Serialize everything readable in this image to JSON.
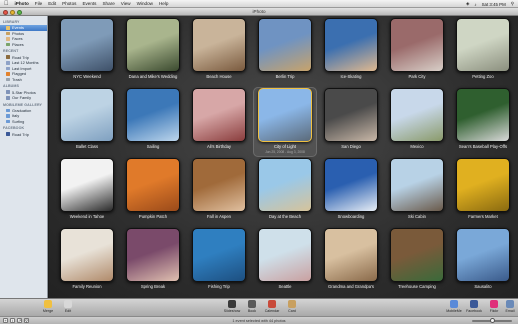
{
  "menubar": {
    "app": "iPhoto",
    "items": [
      "File",
      "Edit",
      "Photos",
      "Events",
      "Share",
      "View",
      "Window",
      "Help"
    ],
    "status": [
      "Sat 3:45 PM"
    ]
  },
  "window": {
    "title": "iPhoto"
  },
  "sidebar": {
    "sections": [
      {
        "title": "LIBRARY",
        "items": [
          {
            "label": "Events",
            "icon": "events-icon",
            "color": "#e8c26a",
            "selected": true
          },
          {
            "label": "Photos",
            "icon": "photos-icon",
            "color": "#c8a060"
          },
          {
            "label": "Faces",
            "icon": "faces-icon",
            "color": "#e1b780"
          },
          {
            "label": "Places",
            "icon": "places-icon",
            "color": "#7aa36a"
          }
        ]
      },
      {
        "title": "RECENT",
        "items": [
          {
            "label": "Road Trip",
            "icon": "event-icon",
            "color": "#8b6b3f"
          },
          {
            "label": "Last 12 Months",
            "icon": "calendar-icon",
            "color": "#8ea2c7"
          },
          {
            "label": "Last Import",
            "icon": "import-icon",
            "color": "#8ea2c7"
          },
          {
            "label": "Flagged",
            "icon": "flag-icon",
            "color": "#e3822c"
          },
          {
            "label": "Trash",
            "icon": "trash-icon",
            "color": "#9aa4ae"
          }
        ]
      },
      {
        "title": "ALBUMS",
        "items": [
          {
            "label": "5-Star Photos",
            "icon": "smart-album-icon",
            "color": "#7f93b9"
          },
          {
            "label": "Our Family",
            "icon": "album-icon",
            "color": "#7f93b9"
          }
        ]
      },
      {
        "title": "MOBILEME GALLERY",
        "items": [
          {
            "label": "Graduation",
            "icon": "gallery-icon",
            "color": "#6b9ad6"
          },
          {
            "label": "Italy",
            "icon": "gallery-icon",
            "color": "#6b9ad6"
          },
          {
            "label": "Surfing",
            "icon": "gallery-icon",
            "color": "#6b9ad6"
          }
        ]
      },
      {
        "title": "FACEBOOK",
        "items": [
          {
            "label": "Road Trip",
            "icon": "facebook-icon",
            "color": "#3b5998"
          }
        ]
      }
    ]
  },
  "events": [
    {
      "title": "NYC Weekend",
      "colors": [
        "#7f9bb8",
        "#3e5068"
      ]
    },
    {
      "title": "Dana and Mike's Wedding",
      "colors": [
        "#a9b58d",
        "#3b4a2f"
      ]
    },
    {
      "title": "Beach House",
      "colors": [
        "#c9b49a",
        "#7a5a3e"
      ]
    },
    {
      "title": "Berlin Trip",
      "colors": [
        "#6f93c2",
        "#c8a36b"
      ]
    },
    {
      "title": "Ice-Skating",
      "colors": [
        "#3b6fb0",
        "#e0b98f"
      ]
    },
    {
      "title": "Park City",
      "colors": [
        "#9a6a6a",
        "#d8cfc8"
      ]
    },
    {
      "title": "Petting Zoo",
      "colors": [
        "#cfd6c4",
        "#8b8f7e"
      ]
    },
    {
      "title": "Ballet Class",
      "colors": [
        "#bdd3e4",
        "#7fa0c0"
      ]
    },
    {
      "title": "Sailing",
      "colors": [
        "#3c78b8",
        "#bdd6ec"
      ]
    },
    {
      "title": "Ali's Birthday",
      "colors": [
        "#d7a7a7",
        "#8a3d3d"
      ]
    },
    {
      "title": "City of Light",
      "dates": "Jun 25, 2008 - Aug 3, 2008",
      "colors": [
        "#8bb7e8",
        "#5b6a7a"
      ],
      "selected": true
    },
    {
      "title": "San Diego",
      "colors": [
        "#4a4a4a",
        "#c9b8a8"
      ]
    },
    {
      "title": "Mexico",
      "colors": [
        "#c8d8ea",
        "#8a9a6a"
      ]
    },
    {
      "title": "Sean's Baseball Play-Offs",
      "colors": [
        "#2f5f2f",
        "#d9d9d9"
      ]
    },
    {
      "title": "Weekend in Tahoe",
      "colors": [
        "#f2f2f2",
        "#2a2a2a"
      ]
    },
    {
      "title": "Pumpkin Patch",
      "colors": [
        "#e07a2a",
        "#9a4a1a"
      ]
    },
    {
      "title": "Fall in Aspen",
      "colors": [
        "#a06a3a",
        "#e0c0a0"
      ]
    },
    {
      "title": "Day at the Beach",
      "colors": [
        "#9ac8e8",
        "#d6c39a"
      ]
    },
    {
      "title": "Snowboarding",
      "colors": [
        "#2a5fb0",
        "#e8eef5"
      ]
    },
    {
      "title": "Ski Cabin",
      "colors": [
        "#b8d2e6",
        "#6a5a4a"
      ]
    },
    {
      "title": "Farmers Market",
      "colors": [
        "#e0b020",
        "#8a6a10"
      ]
    },
    {
      "title": "Family Reunion",
      "colors": [
        "#e8e2d8",
        "#b08a6a"
      ]
    },
    {
      "title": "Spring Break",
      "colors": [
        "#7a4a6a",
        "#e0c0b0"
      ]
    },
    {
      "title": "Fishing Trip",
      "colors": [
        "#2f7fc0",
        "#1d4f80"
      ]
    },
    {
      "title": "Seattle",
      "colors": [
        "#cfe0ea",
        "#c9a0a0"
      ]
    },
    {
      "title": "Grandma and Grandpa's",
      "colors": [
        "#d8c0a0",
        "#8a6a4a"
      ]
    },
    {
      "title": "Treehouse Camping",
      "colors": [
        "#7a5a3a",
        "#3a6a3a"
      ]
    },
    {
      "title": "Sausalito",
      "colors": [
        "#7aa8d8",
        "#3a5a8a"
      ]
    }
  ],
  "toolbar": {
    "left": [
      {
        "label": "Merge",
        "icon": "merge-icon",
        "color": "#f0c040"
      },
      {
        "label": "Edit",
        "icon": "edit-icon",
        "color": "#d8d8d8"
      }
    ],
    "center": [
      {
        "label": "Slideshow",
        "icon": "slideshow-icon",
        "color": "#3a3a3a"
      },
      {
        "label": "Book",
        "icon": "book-icon",
        "color": "#5a5a5a"
      },
      {
        "label": "Calendar",
        "icon": "calendar-icon",
        "color": "#c84a3a"
      },
      {
        "label": "Card",
        "icon": "card-icon",
        "color": "#c8a060"
      }
    ],
    "right": [
      {
        "label": "MobileMe",
        "icon": "mobileme-icon",
        "color": "#5a8ad8"
      },
      {
        "label": "Facebook",
        "icon": "facebook-icon",
        "color": "#3b5998"
      },
      {
        "label": "Flickr",
        "icon": "flickr-icon",
        "color": "#e0307a"
      },
      {
        "label": "Email",
        "icon": "email-icon",
        "color": "#6a8ab8"
      }
    ]
  },
  "status": {
    "text": "1 event selected with 44 photos"
  },
  "zoom": {
    "level": 0.5
  }
}
